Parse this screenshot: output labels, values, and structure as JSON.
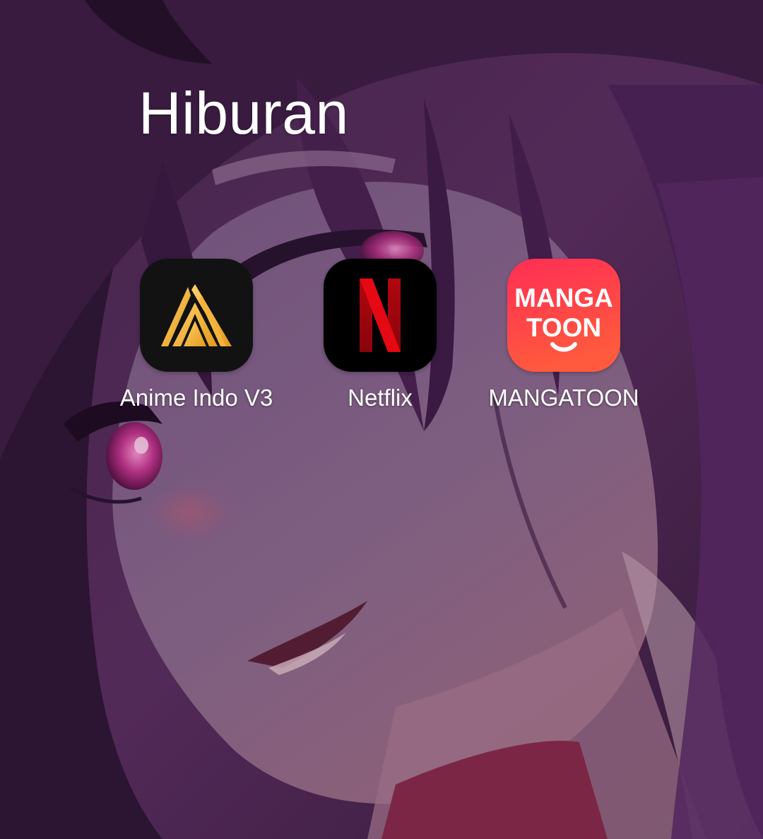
{
  "folder": {
    "title": "Hiburan"
  },
  "apps": [
    {
      "label": "Anime Indo V3",
      "icon": "anime-indo-logo-icon"
    },
    {
      "label": "Netflix",
      "icon": "netflix-logo-icon"
    },
    {
      "label": "MANGATOON",
      "icon": "mangatoon-logo-icon",
      "icon_text_line1": "MANGA",
      "icon_text_line2": "TOON"
    }
  ],
  "colors": {
    "anime_icon_bg": "#121212",
    "anime_icon_gold": "#f2b233",
    "netflix_icon_bg": "#000000",
    "netflix_red": "#e50914",
    "mangatoon_gradient_top": "#ff2d55",
    "mangatoon_gradient_bottom": "#ff5a3d"
  }
}
